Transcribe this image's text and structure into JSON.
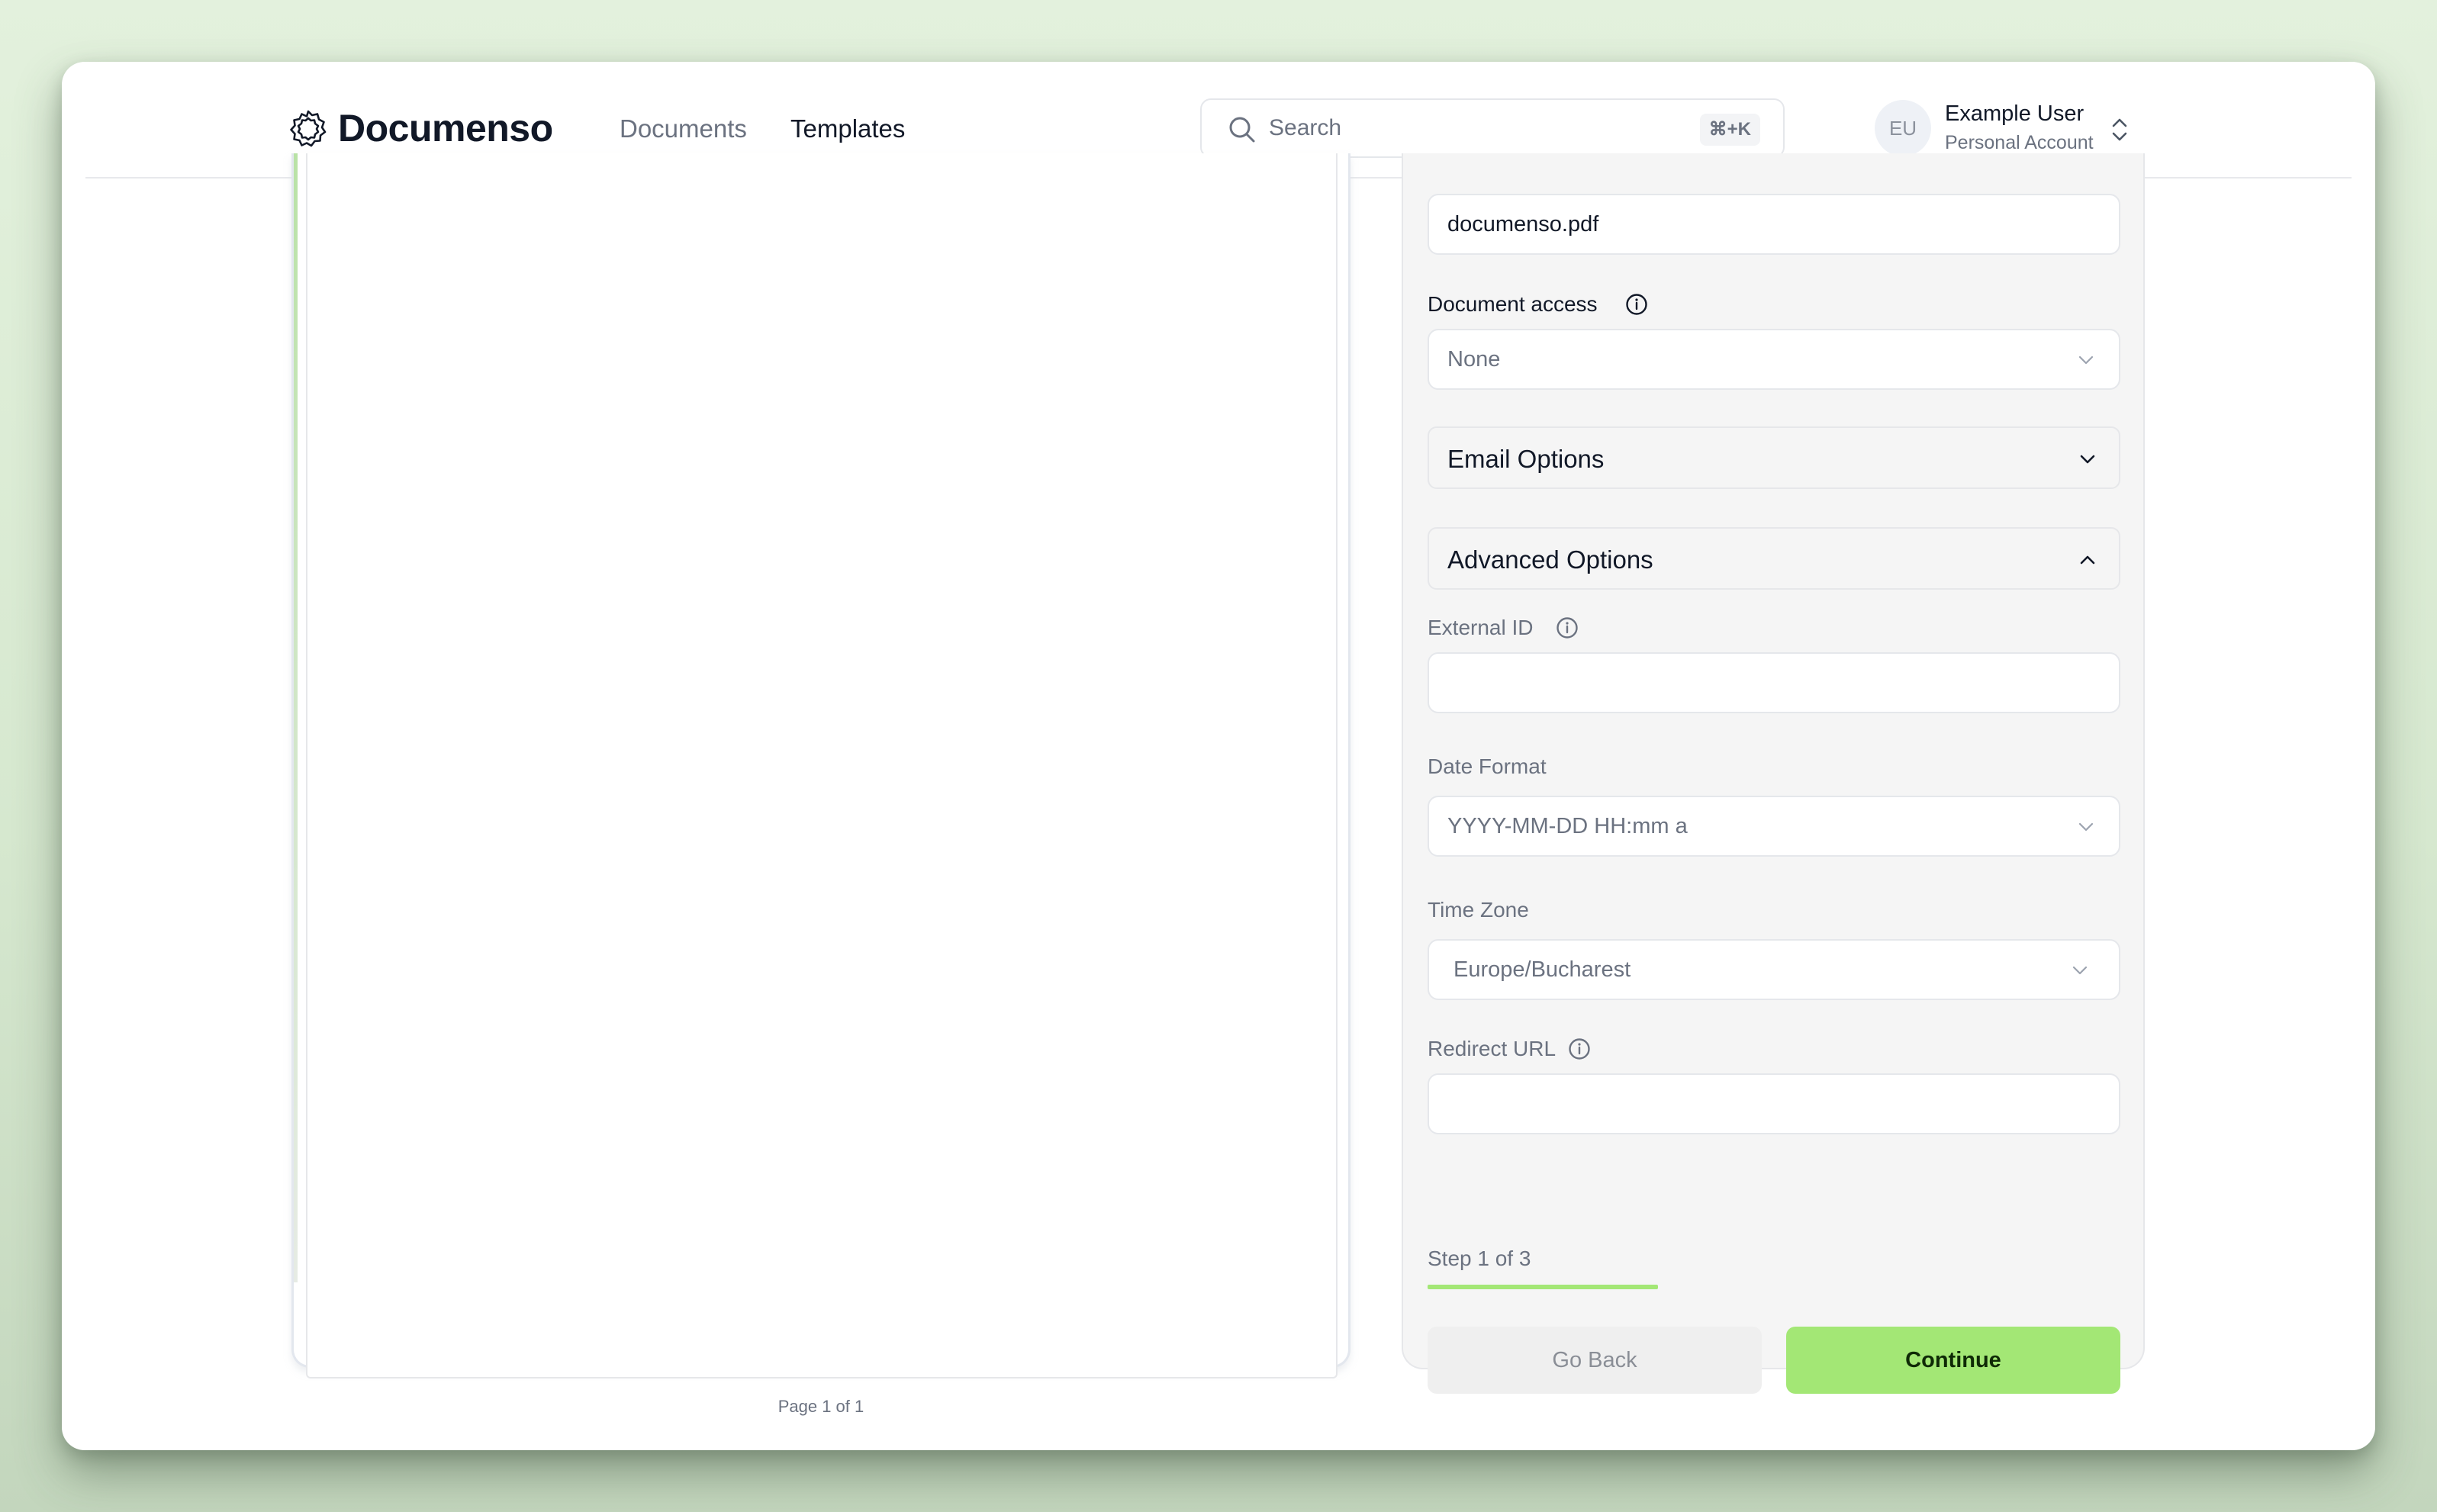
{
  "app": {
    "brand": "Documenso",
    "logo_icon": "documenso-badge-icon"
  },
  "nav": {
    "items": [
      {
        "label": "Documents",
        "active": false
      },
      {
        "label": "Templates",
        "active": true
      }
    ]
  },
  "search": {
    "placeholder": "Search",
    "shortcut": "⌘+K",
    "icon": "search-icon"
  },
  "user": {
    "initials": "EU",
    "name": "Example User",
    "account": "Personal Account",
    "switch_icon": "chevrons-up-down-icon"
  },
  "document": {
    "page_label": "Page 1 of 1"
  },
  "form": {
    "title_value": "documenso.pdf",
    "document_access": {
      "label": "Document access",
      "value": "None"
    },
    "email_options": {
      "label": "Email Options",
      "expanded": false
    },
    "advanced_options": {
      "label": "Advanced Options",
      "expanded": true
    },
    "external_id": {
      "label": "External ID",
      "value": ""
    },
    "date_format": {
      "label": "Date Format",
      "value": "YYYY-MM-DD HH:mm a"
    },
    "time_zone": {
      "label": "Time Zone",
      "value": "Europe/Bucharest"
    },
    "redirect_url": {
      "label": "Redirect URL",
      "value": ""
    }
  },
  "stepper": {
    "label": "Step 1 of 3",
    "current": 1,
    "total": 3,
    "progress_fraction": 0.333
  },
  "actions": {
    "back_label": "Go Back",
    "continue_label": "Continue"
  },
  "colors": {
    "accent": "#a3e775",
    "panel_bg": "#f5f5f5",
    "text_primary": "#111827",
    "text_muted": "#6b7280"
  }
}
